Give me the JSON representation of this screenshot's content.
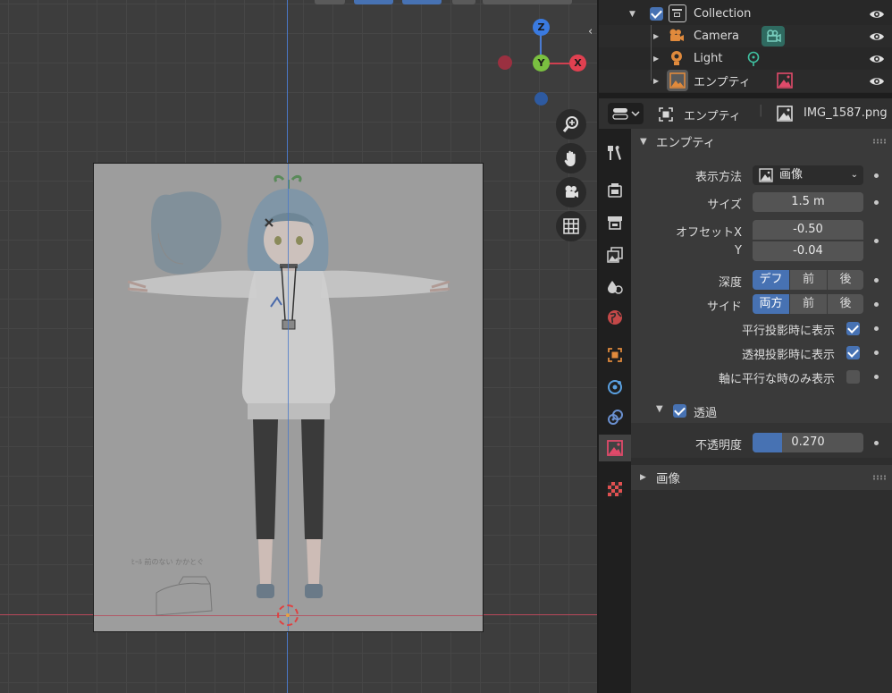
{
  "viewport": {
    "gizmo": {
      "z_label": "Z",
      "y_label": "Y",
      "x_label": "X"
    },
    "nav_buttons": [
      "zoom-icon",
      "hand-pan-icon",
      "camera-view-icon",
      "grid-ortho-icon"
    ]
  },
  "outliner": {
    "collection": {
      "label": "Collection"
    },
    "items": [
      {
        "label": "Camera",
        "type_icon": "camera-icon",
        "data_icon": "camera-data-icon"
      },
      {
        "label": "Light",
        "type_icon": "light-icon",
        "data_icon": "light-data-icon"
      },
      {
        "label": "エンプティ",
        "type_icon": "image-empty-icon",
        "data_icon": "image-data-icon"
      }
    ]
  },
  "properties": {
    "header": {
      "object_name": "エンプティ",
      "image_name": "IMG_1587.png"
    },
    "empty_panel": {
      "title": "エンプティ",
      "display_as": {
        "label": "表示方法",
        "value": "画像"
      },
      "size": {
        "label": "サイズ",
        "value": "1.5 m"
      },
      "offset_x": {
        "label": "オフセットX",
        "value": "-0.50"
      },
      "offset_y": {
        "label": "Y",
        "value": "-0.04"
      },
      "depth": {
        "label": "深度",
        "options": [
          "デフ",
          "前",
          "後"
        ],
        "selected": "デフ"
      },
      "side": {
        "label": "サイド",
        "options": [
          "両方",
          "前",
          "後"
        ],
        "selected": "両方"
      },
      "show_ortho": {
        "label": "平行投影時に表示",
        "checked": true
      },
      "show_persp": {
        "label": "透視投影時に表示",
        "checked": true
      },
      "only_axis_aligned": {
        "label": "軸に平行な時のみ表示",
        "checked": false
      },
      "transparency": {
        "label": "透過",
        "checked": true
      },
      "opacity": {
        "label": "不透明度",
        "value": "0.270",
        "fraction": 0.27
      }
    },
    "image_panel": {
      "title": "画像"
    }
  },
  "colors": {
    "accent": "#4772b3",
    "axis_x": "#b8485a",
    "axis_y": "#4a78c8"
  }
}
